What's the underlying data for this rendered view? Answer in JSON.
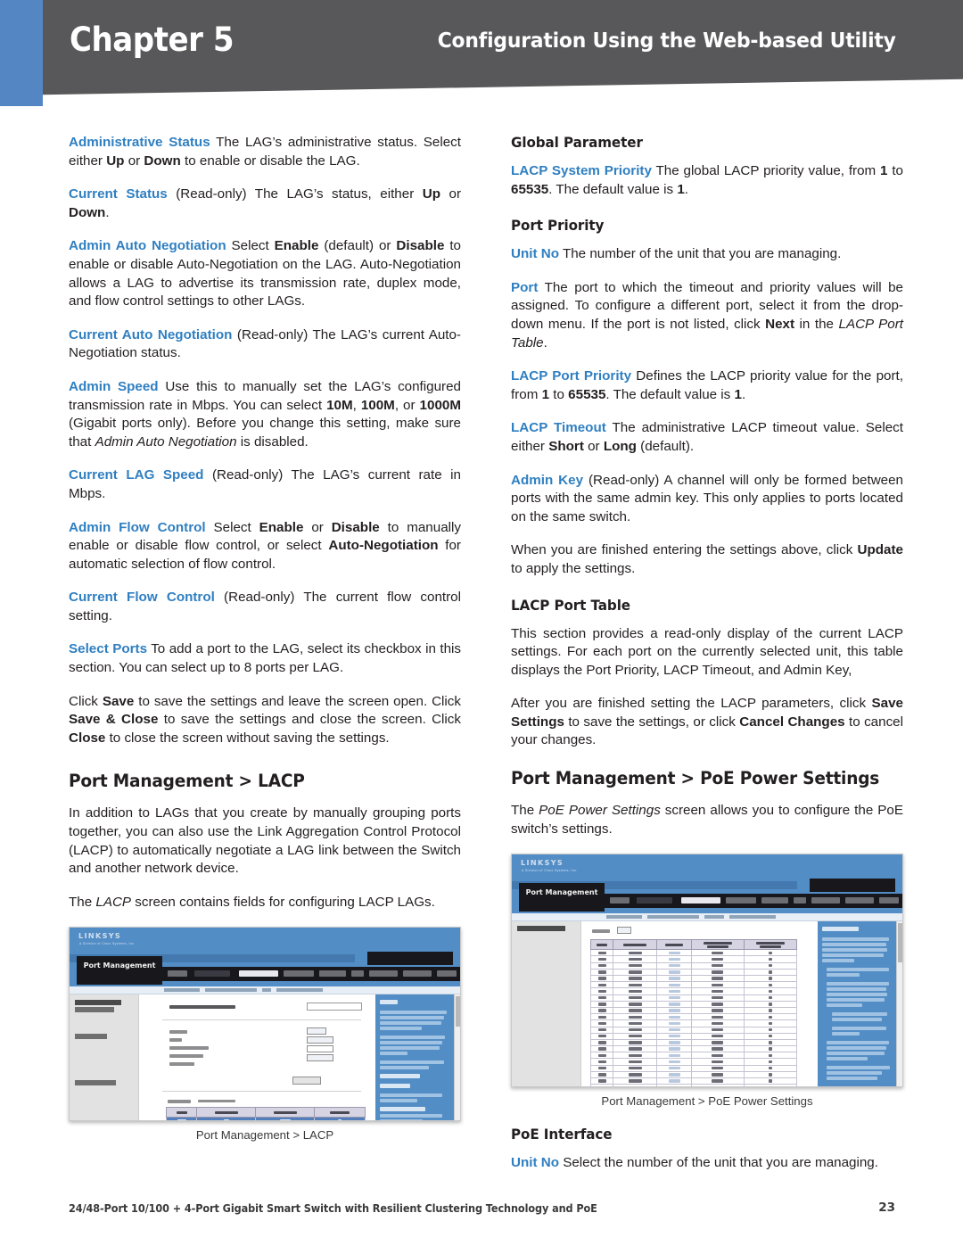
{
  "header": {
    "chapter_label": "Chapter 5",
    "section_title": "Configuration Using the Web-based Utility"
  },
  "left_column": {
    "paragraphs": [
      {
        "id": "administrative-status",
        "term": "Administrative Status",
        "text": " The LAG’s administrative status. Select either ",
        "rest_bold_1": "Up",
        "mid_1": " or ",
        "rest_bold_2": "Down",
        "tail": " to enable or disable the LAG."
      },
      {
        "id": "current-status",
        "term": "Current Status",
        "text": "  (Read-only) The LAG’s status, either ",
        "rest_bold_1": "Up",
        "mid_1": " or ",
        "rest_bold_2": "Down",
        "tail": "."
      },
      {
        "id": "admin-auto-negotiation",
        "term": "Admin Auto Negotiation",
        "text": " Select ",
        "rest_bold_1": "Enable",
        "mid_1": " (default) or ",
        "rest_bold_2": "Disable",
        "tail": " to enable or disable Auto-Negotiation on the LAG. Auto-Negotiation allows a LAG to advertise its transmission rate, duplex mode, and flow control settings to other LAGs."
      },
      {
        "id": "current-auto-negotiation",
        "term": "Current Auto Negotiation",
        "text": "  (Read-only) The LAG’s current Auto-Negotiation status."
      },
      {
        "id": "admin-speed",
        "term": "Admin Speed",
        "text": " Use this to manually set the LAG’s configured transmission rate in Mbps. You can select ",
        "rest_bold_1": "10M",
        "mid_1": ", ",
        "rest_bold_2": "100M",
        "mid_2": ", or ",
        "rest_bold_3": "1000M",
        "tail": " (Gigabit ports only). Before you change this setting, make sure that ",
        "italic_1": "Admin Auto Negotiation",
        "tail2": " is disabled."
      },
      {
        "id": "current-lag-speed",
        "term": "Current LAG Speed",
        "text": "  (Read-only) The LAG’s current rate in Mbps."
      },
      {
        "id": "admin-flow-control",
        "term": "Admin Flow Control",
        "text": " Select ",
        "rest_bold_1": "Enable",
        "mid_1": " or ",
        "rest_bold_2": "Disable",
        "mid_2": " to manually enable or disable flow control, or select ",
        "rest_bold_3": "Auto-Negotiation",
        "tail": " for automatic selection of flow control."
      },
      {
        "id": "current-flow-control",
        "term": "Current Flow Control",
        "text": " (Read-only) The current flow control setting."
      },
      {
        "id": "select-ports",
        "term": "Select Ports",
        "text": "  To add a port to the LAG, select its checkbox in this section. You can select up to 8 ports per LAG."
      }
    ],
    "save_paragraph": {
      "p1": "Click ",
      "b1": "Save",
      "p2": " to save the settings and leave the screen open. Click ",
      "b2": "Save & Close",
      "p3": " to save the settings and close the screen. Click ",
      "b3": "Close",
      "p4": " to close the screen without saving the settings."
    },
    "lacp_heading": "Port Management > LACP",
    "lacp_intro": "In addition to LAGs that you create by manually grouping ports together, you can also use the Link Aggregation Control Protocol (LACP) to automatically negotiate a LAG link between the Switch and another network device.",
    "lacp_screen_note": {
      "p1": "The ",
      "i1": "LACP",
      "p2": " screen contains fields for configuring LACP LAGs."
    },
    "figure_caption": "Port Management > LACP"
  },
  "right_column": {
    "global_parameter_heading": "Global Parameter",
    "lacp_system_priority": {
      "term": "LACP System Priority",
      "p1": " The global LACP priority value, from ",
      "b1": "1",
      "p2": " to ",
      "b2": "65535",
      "p3": ". The default value is ",
      "b3": "1",
      "p4": "."
    },
    "port_priority_heading": "Port Priority",
    "unit_no": {
      "term": "Unit No",
      "text": "  The number of the unit that you are managing."
    },
    "port": {
      "term": "Port",
      "p1": "  The port to which the timeout and priority values will be assigned. To configure a different port, select it from the drop-down menu. If the port is not listed, click ",
      "b1": "Next",
      "p2": " in the ",
      "i1": "LACP Port Table",
      "p3": "."
    },
    "lacp_port_priority": {
      "term": "LACP Port Priority",
      "p1": "  Defines the LACP priority value for the port, from ",
      "b1": "1",
      "p2": " to ",
      "b2": "65535",
      "p3": ". The default value is ",
      "b3": "1",
      "p4": "."
    },
    "lacp_timeout": {
      "term": "LACP Timeout",
      "p1": "  The administrative LACP timeout value. Select either ",
      "b1": "Short",
      "p2": " or ",
      "b2": "Long",
      "p3": " (default)."
    },
    "admin_key": {
      "term": "Admin Key",
      "text": "  (Read-only) A channel will only be formed between ports with the same admin key. This only applies to ports located on the same switch."
    },
    "update_paragraph": {
      "p1": "When you are finished entering the settings above, click ",
      "b1": "Update",
      "p2": " to apply the settings."
    },
    "lacp_port_table_heading": "LACP Port Table",
    "lacp_port_table_text": "This section provides a read-only display of the current LACP settings. For each port on the currently selected unit, this table displays the Port Priority, LACP Timeout, and Admin Key,",
    "save_settings_paragraph": {
      "p1": "After you are finished setting the LACP parameters, click ",
      "b1": "Save Settings",
      "p2": " to save the settings, or click ",
      "b2": "Cancel Changes",
      "p3": " to cancel your changes."
    },
    "poe_heading": "Port Management > PoE Power Settings",
    "poe_intro": {
      "p1": "The ",
      "i1": "PoE Power Settings",
      "p2": " screen allows you to configure the PoE switch’s settings."
    },
    "figure_caption": "Port Management > PoE Power Settings",
    "poe_interface_heading": "PoE Interface",
    "poe_unit_no": {
      "term": "Unit No",
      "text": " Select the number of the unit that you are managing."
    }
  },
  "screenshots": {
    "lacp": {
      "module_tab": "Port Management",
      "sidebar_labels": [
        "Global Parameter",
        "Port Priority",
        "LACP Port Table"
      ]
    },
    "poe": {
      "module_tab": "Port Management",
      "sidebar_labels": [
        "PoE Interface"
      ]
    }
  },
  "footer": {
    "product": "24/48-Port 10/100 + 4-Port Gigabit Smart Switch with Resilient Clustering Technology and PoE",
    "page_number": "23"
  },
  "colors": {
    "accent_blue": "#2f7fc1",
    "header_gray": "#58585a",
    "header_bar_blue": "#5586c4",
    "ui_blue": "#4f8ecb"
  }
}
